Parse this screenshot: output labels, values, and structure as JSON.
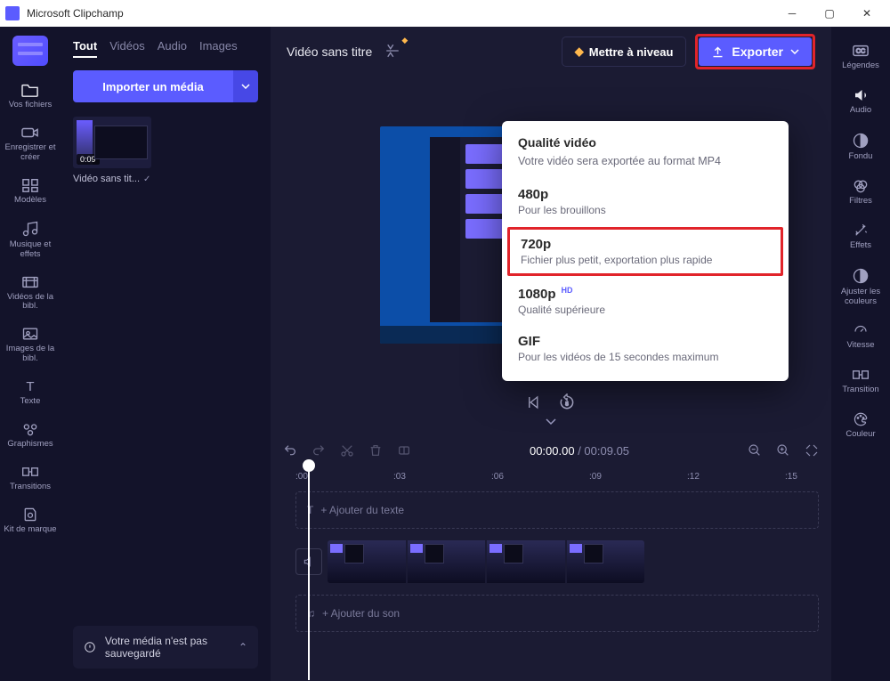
{
  "window": {
    "title": "Microsoft Clipchamp"
  },
  "left_rail": {
    "items": [
      {
        "label": "Vos fichiers"
      },
      {
        "label": "Enregistrer et créer"
      },
      {
        "label": "Modèles"
      },
      {
        "label": "Musique et effets"
      },
      {
        "label": "Vidéos de la bibl."
      },
      {
        "label": "Images de la bibl."
      },
      {
        "label": "Texte"
      },
      {
        "label": "Graphismes"
      },
      {
        "label": "Transitions"
      },
      {
        "label": "Kit de marque"
      }
    ]
  },
  "media_panel": {
    "tabs": [
      {
        "label": "Tout",
        "active": true
      },
      {
        "label": "Vidéos"
      },
      {
        "label": "Audio"
      },
      {
        "label": "Images"
      }
    ],
    "import_label": "Importer un média",
    "clip": {
      "duration": "0:09",
      "title": "Vidéo sans tit..."
    },
    "banner": "Votre média n'est pas sauvegardé"
  },
  "header": {
    "project_title": "Vidéo sans titre",
    "upgrade": "Mettre à niveau",
    "export": "Exporter"
  },
  "export_menu": {
    "title": "Qualité vidéo",
    "subtitle": "Votre vidéo sera exportée au format MP4",
    "options": [
      {
        "res": "480p",
        "desc": "Pour les brouillons"
      },
      {
        "res": "720p",
        "desc": "Fichier plus petit, exportation plus rapide",
        "highlight": true
      },
      {
        "res": "1080p",
        "desc": "Qualité supérieure",
        "hd": "HD"
      },
      {
        "res": "GIF",
        "desc": "Pour les vidéos de 15 secondes maximum"
      }
    ]
  },
  "timeline": {
    "current": "00:00.00",
    "total": "00:09.05",
    "ticks": [
      ":00",
      ":03",
      ":06",
      ":09",
      ":12",
      ":15"
    ],
    "add_text": "+ Ajouter du texte",
    "add_sound": "+ Ajouter du son"
  },
  "right_rail": {
    "items": [
      {
        "label": "Légendes"
      },
      {
        "label": "Audio"
      },
      {
        "label": "Fondu"
      },
      {
        "label": "Filtres"
      },
      {
        "label": "Effets"
      },
      {
        "label": "Ajuster les couleurs"
      },
      {
        "label": "Vitesse"
      },
      {
        "label": "Transition"
      },
      {
        "label": "Couleur"
      }
    ]
  }
}
